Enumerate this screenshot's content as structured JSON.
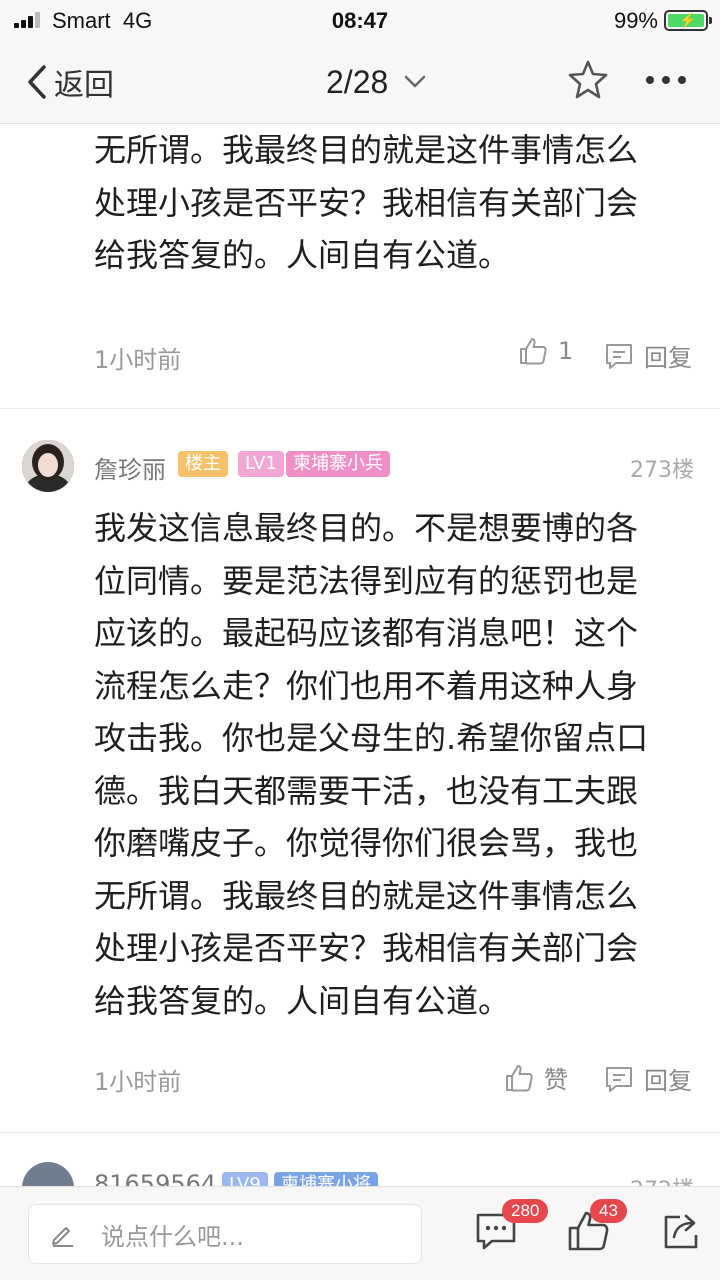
{
  "status_bar": {
    "carrier": "Smart",
    "network": "4G",
    "time": "08:47",
    "battery": "99%"
  },
  "nav": {
    "back_label": "返回",
    "page_indicator": "2/28"
  },
  "prev_post": {
    "lines": [
      "无所谓。我最终目的就是这件事情怎么",
      "处理小孩是否平安？我相信有关部门会",
      "给我答复的。人间自有公道。"
    ],
    "time": "1小时前",
    "like_count": "1",
    "reply_label": "回复"
  },
  "main_post": {
    "username": "詹珍丽",
    "badge_owner": "楼主",
    "badge_level": "LV1",
    "badge_title": "柬埔寨小兵",
    "floor": "273楼",
    "lines": [
      "我发这信息最终目的。不是想要博的各",
      "位同情。要是范法得到应有的惩罚也是",
      "应该的。最起码应该都有消息吧！这个",
      "流程怎么走？你们也用不着用这种人身",
      "攻击我。你也是父母生的.希望你留点口",
      "德。我白天都需要干活，也没有工夫跟",
      "你磨嘴皮子。你觉得你们很会骂，我也",
      "无所谓。我最终目的就是这件事情怎么",
      "处理小孩是否平安？我相信有关部门会",
      "给我答复的。人间自有公道。"
    ],
    "time": "1小时前",
    "like_label": "赞",
    "reply_label": "回复"
  },
  "next_post": {
    "username": "81659564",
    "badge_level": "LV9",
    "badge_title": "柬埔寨小将",
    "floor": "272楼"
  },
  "bottom_bar": {
    "input_placeholder": "说点什么吧...",
    "comment_count": "280",
    "like_count": "43"
  },
  "colors": {
    "owner_badge": "#f5c26b",
    "level_badge_lv1": "#f2a6d4",
    "title_badge_pink": "#f08fc5",
    "level_badge_lv9": "#9ab8ee",
    "title_badge_blue": "#7aa3e5",
    "count_badge": "#e5474b",
    "battery": "#4cd964"
  }
}
